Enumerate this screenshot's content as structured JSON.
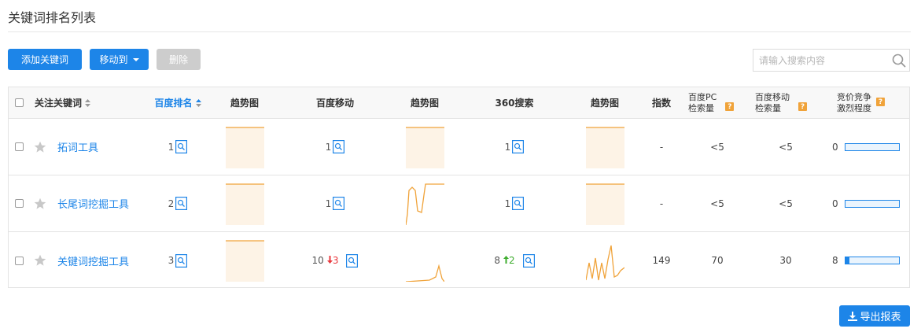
{
  "page": {
    "title": "关键词排名列表"
  },
  "toolbar": {
    "add_label": "添加关键词",
    "move_label": "移动到",
    "delete_label": "删除",
    "search_placeholder": "请输入搜索内容"
  },
  "table": {
    "headers": {
      "keyword": "关注关键词",
      "baidu_rank": "百度排名",
      "trend1": "趋势图",
      "baidu_mobile": "百度移动",
      "trend2": "趋势图",
      "so360": "360搜索",
      "trend3": "趋势图",
      "index": "指数",
      "pc_volume_line1": "百度PC",
      "pc_volume_line2": "检索量",
      "mobile_volume_line1": "百度移动",
      "mobile_volume_line2": "检索量",
      "competition_line1": "竞价竞争",
      "competition_line2": "激烈程度",
      "help": "?"
    },
    "rows": [
      {
        "keyword": "拓词工具",
        "baidu_rank": "1",
        "baidu_mobile": "1",
        "baidu_mobile_change": "",
        "so360": "1",
        "so360_change": "",
        "index": "-",
        "pc_volume": "<5",
        "mobile_volume": "<5",
        "competition": "0",
        "competition_level": 0
      },
      {
        "keyword": "长尾词挖掘工具",
        "baidu_rank": "2",
        "baidu_mobile": "1",
        "baidu_mobile_change": "",
        "so360": "1",
        "so360_change": "",
        "index": "-",
        "pc_volume": "<5",
        "mobile_volume": "<5",
        "competition": "0",
        "competition_level": 0
      },
      {
        "keyword": "关键词挖掘工具",
        "baidu_rank": "3",
        "baidu_mobile": "10",
        "baidu_mobile_change": "3",
        "so360": "8",
        "so360_change": "2",
        "index": "149",
        "pc_volume": "70",
        "mobile_volume": "30",
        "competition": "8",
        "competition_level": 0.08
      }
    ]
  },
  "export_label": "导出报表",
  "colors": {
    "accent": "#1d85e8",
    "disabled": "#cdcdcd",
    "rank_down": "#e8383d",
    "rank_up": "#3fad2f",
    "help_badge": "#f0a33a",
    "spark_line": "#f0a33a",
    "spark_fill": "#fdf3e6"
  }
}
